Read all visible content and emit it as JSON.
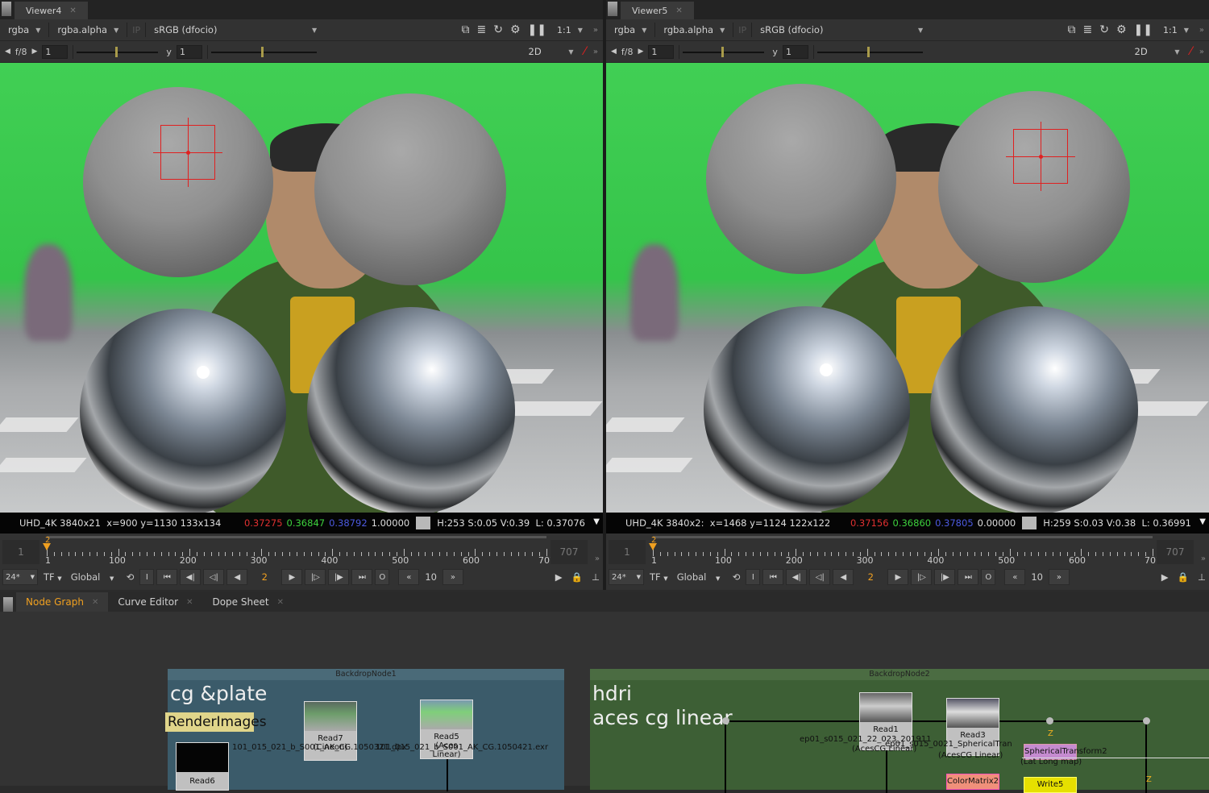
{
  "viewers": [
    {
      "title": "Viewer4",
      "channels": "rgba",
      "alpha": "rgba.alpha",
      "ip": "IP",
      "colorspace": "sRGB (dfocio)",
      "zoom": "1:1",
      "fstop": "f/8",
      "gain": "1",
      "gamma_label": "y",
      "gamma": "1",
      "mode": "2D",
      "status": {
        "format": "UHD_4K 3840x21",
        "coords": "x=900 y=1130 133x134",
        "r": "0.37275",
        "g": "0.36847",
        "b": "0.38792",
        "a": "1.00000",
        "hsv": "H:253 S:0.05 V:0.39",
        "l": "L: 0.37076"
      },
      "target_sphere": "left"
    },
    {
      "title": "Viewer5",
      "channels": "rgba",
      "alpha": "rgba.alpha",
      "ip": "IP",
      "colorspace": "sRGB (dfocio)",
      "zoom": "1:1",
      "fstop": "f/8",
      "gain": "1",
      "gamma_label": "y",
      "gamma": "1",
      "mode": "2D",
      "status": {
        "format": "UHD_4K 3840x2:",
        "coords": "x=1468 y=1124 122x122",
        "r": "0.37156",
        "g": "0.36860",
        "b": "0.37805",
        "a": "0.00000",
        "hsv": "H:259 S:0.03 V:0.38",
        "l": "L: 0.36991"
      },
      "target_sphere": "right"
    }
  ],
  "timeline": {
    "start": "1",
    "end": "707",
    "current": "2",
    "ticks": [
      "1",
      "100",
      "200",
      "300",
      "400",
      "500",
      "600",
      "707"
    ],
    "fps": "24*",
    "tf": "TF",
    "scope": "Global",
    "step": "10",
    "in": "I",
    "out": "O"
  },
  "bottom_tabs": [
    {
      "label": "Node Graph",
      "active": true
    },
    {
      "label": "Curve Editor"
    },
    {
      "label": "Dope Sheet"
    }
  ],
  "node_graph": {
    "backdrop1": {
      "name": "BackdropNode1",
      "title": "cg &plate",
      "color": "#3b5b6a",
      "sticky": "RenderImages",
      "nodes": [
        {
          "name": "Read6"
        },
        {
          "name": "Read7",
          "sub": "(Cineon)"
        },
        {
          "name": "Read5",
          "sub": "(Aces Linear)"
        }
      ],
      "labels": [
        "101_015_021_b_S001_AK_CG.1050321.dpx",
        "101_015_021_b_S001_AK_CG.1050421.exr"
      ]
    },
    "backdrop2": {
      "name": "BackdropNode2",
      "title1": "hdri",
      "title2": "aces cg linear",
      "color": "#3d5f35",
      "nodes": [
        {
          "name": "Read1",
          "sub": "(AcesCG Linear)"
        },
        {
          "name": "Read3",
          "sub": "(AcesCG Linear)"
        },
        {
          "name": "SphericalTransform2",
          "sub": "(Lat Long map)"
        },
        {
          "name": "ColorMatrix2"
        },
        {
          "name": "Write5"
        }
      ],
      "labels": [
        "ep01_s015_021_22_023_201911",
        "ep01_s015_0021_SphericalTran"
      ],
      "z": "Z"
    }
  }
}
